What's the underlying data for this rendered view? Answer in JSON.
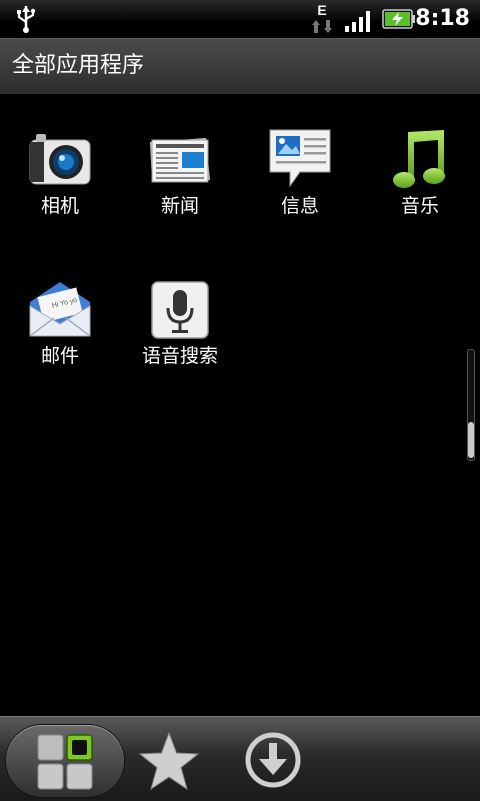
{
  "status_bar": {
    "time": "8:18",
    "network_type": "E",
    "icons": [
      "usb-icon",
      "network-icon",
      "signal-icon",
      "battery-charging-icon"
    ]
  },
  "header": {
    "title": "全部应用程序"
  },
  "apps": [
    {
      "label": "相机",
      "icon": "camera-icon"
    },
    {
      "label": "新闻",
      "icon": "news-icon"
    },
    {
      "label": "信息",
      "icon": "messages-icon"
    },
    {
      "label": "音乐",
      "icon": "music-icon"
    },
    {
      "label": "邮件",
      "icon": "mail-icon"
    },
    {
      "label": "语音搜索",
      "icon": "microphone-icon"
    }
  ],
  "mail_envelope_text": "Hi Yo yo",
  "dock": {
    "items": [
      "all-apps-grid-icon",
      "star-icon",
      "download-arrow-icon"
    ]
  },
  "colors": {
    "background": "#000000",
    "accent_green": "#7ec621",
    "titlebar": "#3a3a3a"
  }
}
